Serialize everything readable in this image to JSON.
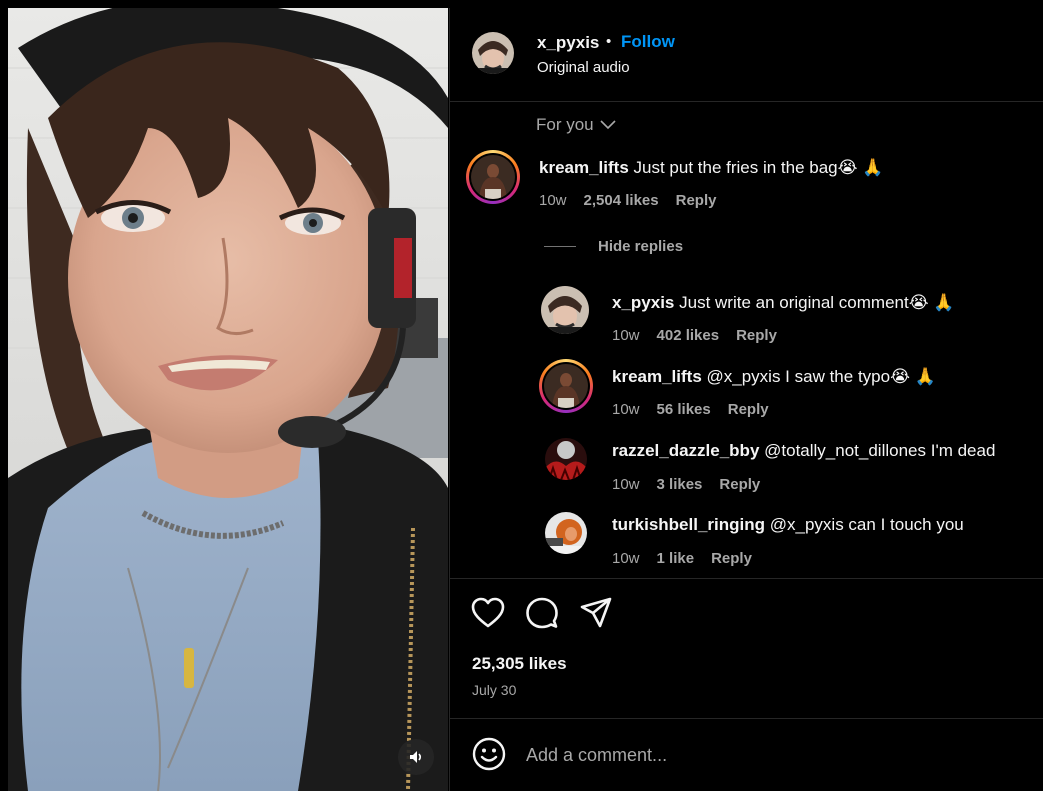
{
  "post": {
    "username": "x_pyxis",
    "separator": "•",
    "follow_label": "Follow",
    "audio_label": "Original audio",
    "likes": "25,305 likes",
    "date": "July 30"
  },
  "comments_filter": "For you",
  "comments": [
    {
      "username": "kream_lifts",
      "text": "Just put the fries in the bag😭 🙏",
      "age": "10w",
      "likes": "2,504 likes",
      "reply_label": "Reply"
    }
  ],
  "hide_replies_label": "Hide replies",
  "replies": [
    {
      "username": "x_pyxis",
      "text": "Just write an original comment😭 🙏",
      "age": "10w",
      "likes": "402 likes",
      "reply_label": "Reply"
    },
    {
      "username": "kream_lifts",
      "text": "@x_pyxis I saw the typo😭 🙏",
      "age": "10w",
      "likes": "56 likes",
      "reply_label": "Reply"
    },
    {
      "username": "razzel_dazzle_bby",
      "text": "@totally_not_dillones I'm dead",
      "age": "10w",
      "likes": "3 likes",
      "reply_label": "Reply"
    },
    {
      "username": "turkishbell_ringing",
      "text": "@x_pyxis can I touch you",
      "age": "10w",
      "likes": "1 like",
      "reply_label": "Reply"
    }
  ],
  "add_comment_placeholder": "Add a comment...",
  "icons": {
    "like": "heart-icon",
    "comment": "comment-bubble-icon",
    "share": "paper-plane-icon",
    "emoji": "smiley-icon",
    "mute": "speaker-icon",
    "dropdown": "chevron-down-icon"
  },
  "colors": {
    "background": "#000000",
    "text": "#f5f5f5",
    "secondary_text": "#a8a8a8",
    "link_blue": "#0095f6",
    "divider": "#262626"
  }
}
